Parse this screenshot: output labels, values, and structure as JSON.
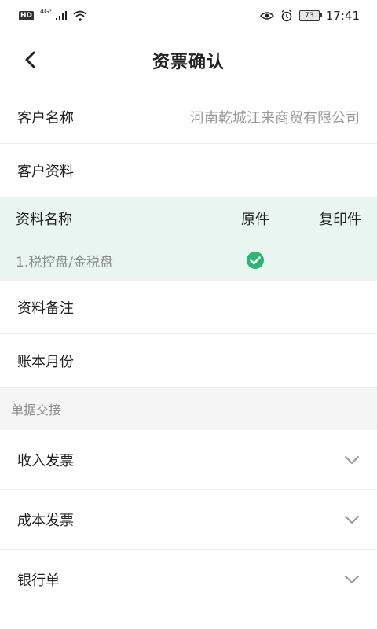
{
  "status_bar": {
    "left_badge": "HD",
    "network": "4G⁺",
    "battery": "73",
    "time": "17:41"
  },
  "header": {
    "title": "资票确认"
  },
  "rows": {
    "customer_name_label": "客户名称",
    "customer_name_value": "河南乾城江来商贸有限公司",
    "customer_docs_label": "客户资料",
    "doc_note_label": "资料备注",
    "account_month_label": "账本月份"
  },
  "docs_table": {
    "headers": {
      "name": "资料名称",
      "original": "原件",
      "copy": "复印件"
    },
    "items": [
      {
        "name": "1.税控盘/金税盘",
        "original_checked": true,
        "copy_checked": false
      }
    ]
  },
  "section": {
    "title": "单据交接"
  },
  "dropdowns": [
    {
      "label": "收入发票"
    },
    {
      "label": "成本发票"
    },
    {
      "label": "银行单"
    }
  ],
  "colors": {
    "accent_green": "#2bb673",
    "table_bg": "#e8f5f1"
  }
}
